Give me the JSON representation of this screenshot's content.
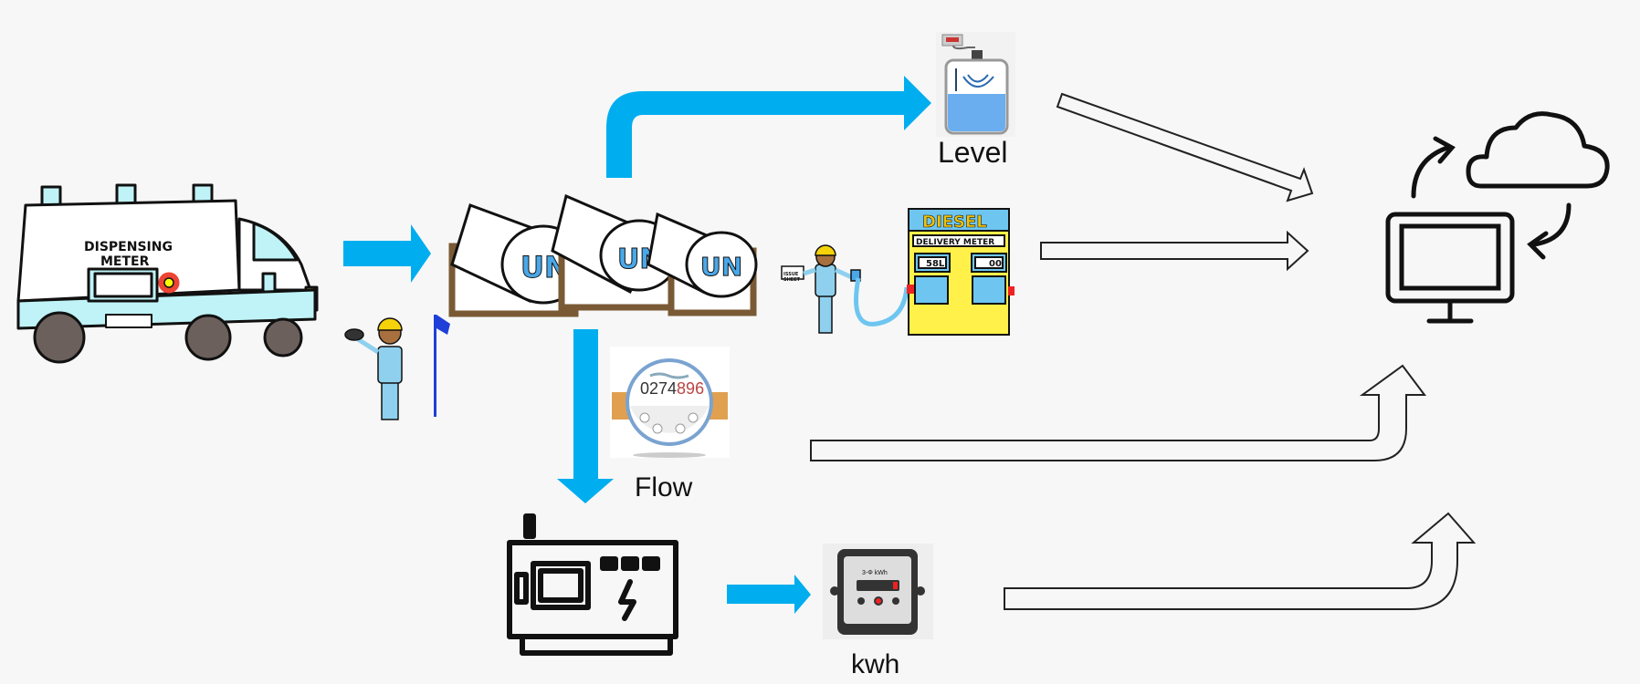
{
  "colors": {
    "background": "#f7f7f7",
    "flow_arrow": "#00aeef",
    "outline_arrow": "#222222",
    "tank_label": "#4aa8e8",
    "pump_yellow": "#fff04a",
    "pump_blue": "#6ec6f0"
  },
  "truck": {
    "label_line1": "DISPENSING",
    "label_line2": "METER"
  },
  "tanks": {
    "labels": [
      "UN",
      "UN",
      "UN"
    ]
  },
  "attendant": {
    "sheet_line1": "ISSUE",
    "sheet_line2": "SHEET"
  },
  "pump": {
    "title": "DIESEL",
    "meter_label": "DELIVERY METER",
    "reading_left": "58L",
    "reading_right": "00"
  },
  "level": {
    "label": "Level"
  },
  "flow": {
    "label": "Flow",
    "digits_black": "0274",
    "digits_red": "896"
  },
  "kwh": {
    "label": "kwh",
    "meter_caption": "3-Φ kWh"
  },
  "icons": [
    "truck-icon",
    "operator-icon",
    "flag-icon",
    "tank-icon",
    "level-sensor-icon",
    "fuel-pump-icon",
    "flow-meter-icon",
    "generator-icon",
    "energy-meter-icon",
    "monitor-icon",
    "cloud-icon",
    "sync-arrows-icon"
  ]
}
